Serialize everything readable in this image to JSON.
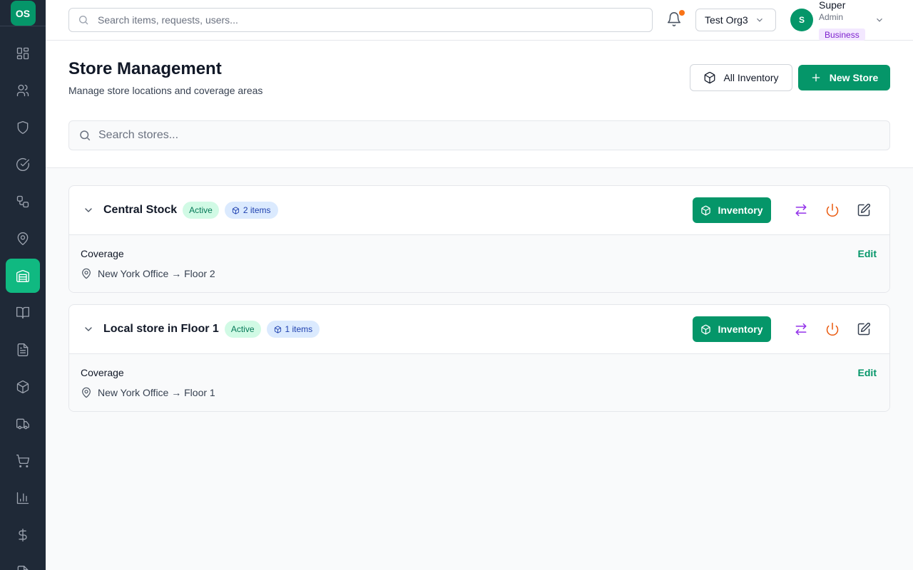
{
  "logo": {
    "text": "OS"
  },
  "sidebar": {
    "items": [
      {
        "name": "dashboard",
        "icon": "grid-icon"
      },
      {
        "name": "users",
        "icon": "users-icon"
      },
      {
        "name": "security",
        "icon": "shield-icon"
      },
      {
        "name": "tasks",
        "icon": "check-circle-icon"
      },
      {
        "name": "workflows",
        "icon": "workflow-icon"
      },
      {
        "name": "locations",
        "icon": "map-pin-icon"
      },
      {
        "name": "stores",
        "icon": "warehouse-icon",
        "active": true
      },
      {
        "name": "catalog",
        "icon": "book-open-icon"
      },
      {
        "name": "documents",
        "icon": "file-text-icon"
      },
      {
        "name": "inventory",
        "icon": "package-icon"
      },
      {
        "name": "shipping",
        "icon": "truck-icon"
      },
      {
        "name": "orders",
        "icon": "cart-icon"
      },
      {
        "name": "reports",
        "icon": "bar-chart-icon"
      },
      {
        "name": "finance",
        "icon": "dollar-icon"
      }
    ]
  },
  "topbar": {
    "search_placeholder": "Search items, requests, users...",
    "org_name": "Test Org3",
    "user": {
      "initial": "S",
      "name": "Super",
      "role": "Admin",
      "plan": "Business"
    }
  },
  "header": {
    "title": "Store Management",
    "subtitle": "Manage store locations and coverage areas",
    "all_inventory_label": "All Inventory",
    "new_store_label": "New Store",
    "search_placeholder": "Search stores..."
  },
  "stores": [
    {
      "name": "Central Stock",
      "status": "Active",
      "items_count": "2 items",
      "inventory_label": "Inventory",
      "coverage_label": "Coverage",
      "edit_label": "Edit",
      "coverage_location": "New York Office → Floor 2"
    },
    {
      "name": "Local store in Floor 1",
      "status": "Active",
      "items_count": "1 items",
      "inventory_label": "Inventory",
      "coverage_label": "Coverage",
      "edit_label": "Edit",
      "coverage_location": "New York Office → Floor 1"
    }
  ],
  "colors": {
    "sidebar_bg": "#1f2937",
    "brand": "#059669",
    "active_nav": "#10b981",
    "notification_dot": "#f97316",
    "transfer_icon": "#9333ea",
    "power_icon": "#ea580c"
  }
}
